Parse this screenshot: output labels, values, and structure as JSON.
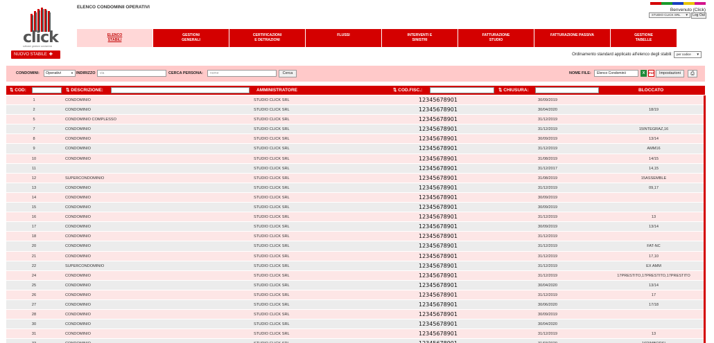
{
  "header": {
    "title": "ELENCO CONDOMINII OPERATIVI",
    "welcome": "Benvenuto",
    "click_link": "(Click)",
    "user_select": "STUDIO CLICK SRL",
    "logout": "Log Out",
    "logo_text": "click",
    "logo_tagline": "software gestione condominio",
    "strip_colors": [
      "#d40000",
      "#1a9a2a",
      "#1a3fbf",
      "#e8c400",
      "#d4148c"
    ]
  },
  "nav": [
    {
      "label": "ELENCO\nSTABILI",
      "active": true
    },
    {
      "label": "GESTIONI\nGENERALI",
      "active": false
    },
    {
      "label": "CERTIFICAZIONI\nE DETRAZIONI",
      "active": false
    },
    {
      "label": "FLUSSI",
      "active": false
    },
    {
      "label": "INTERVENTI E\nSINISTRI",
      "active": false
    },
    {
      "label": "FATTURAZIONE\nSTUDIO",
      "active": false
    },
    {
      "label": "FATTURAZIONE PASSIVA",
      "active": false
    },
    {
      "label": "GESTIONE\nTABELLE",
      "active": false
    }
  ],
  "new_button": "NUOVO STABILE",
  "ordering": {
    "label": "Ordinamento standard applicato all'elenco degli stabili:",
    "value": "per codice"
  },
  "filters": {
    "condomini_label": "CONDOMINI:",
    "condomini_value": "Operativi",
    "indirizzo_label": "INDIRIZZO",
    "indirizzo_placeholder": "via",
    "persona_label": "CERCA PERSONA:",
    "persona_placeholder": "nome",
    "cerca": "Cerca",
    "nome_file_label": "NOME FILE:",
    "nome_file_value": "Elenco Condominii",
    "impostazioni": "Impostazioni"
  },
  "columns": {
    "cod": "COD:",
    "descrizione": "DESCRIZIONE:",
    "amministratore": "AMMINISTRATORE",
    "codfisc": "COD.FISC.:",
    "chiusura": "CHIUSURA:",
    "bloccato": "BLOCCATO"
  },
  "colors": {
    "accent": "#d40000",
    "row_pink": "#fde6e6",
    "row_grey": "#ececec",
    "filter_bg": "#ffc9c9"
  },
  "rows": [
    {
      "cod": "1",
      "desc": "CONDOMINIO",
      "admin": "STUDIO CLICK SRL",
      "cf": "12345678901",
      "chiusura": "30/09/2019",
      "bloccato": ""
    },
    {
      "cod": "2",
      "desc": "CONDOMINIO",
      "admin": "STUDIO CLICK SRL",
      "cf": "12345678901",
      "chiusura": "30/04/2020",
      "bloccato": "18/19"
    },
    {
      "cod": "5",
      "desc": "CONDOMINIO COMPLESSO",
      "admin": "STUDIO CLICK SRL",
      "cf": "12345678901",
      "chiusura": "31/12/2019",
      "bloccato": ""
    },
    {
      "cod": "7",
      "desc": "CONDOMINIO",
      "admin": "STUDIO CLICK SRL",
      "cf": "12345678901",
      "chiusura": "31/12/2019",
      "bloccato": "15INTEGRAZ,16"
    },
    {
      "cod": "8",
      "desc": "CONDOMINIO",
      "admin": "STUDIO CLICK SRL",
      "cf": "12345678901",
      "chiusura": "30/09/2019",
      "bloccato": "13/14"
    },
    {
      "cod": "9",
      "desc": "CONDOMINIO",
      "admin": "STUDIO CLICK SRL",
      "cf": "12345678901",
      "chiusura": "31/12/2019",
      "bloccato": "AMM16"
    },
    {
      "cod": "10",
      "desc": "CONDOMINIO",
      "admin": "STUDIO CLICK SRL",
      "cf": "12345678901",
      "chiusura": "31/08/2019",
      "bloccato": "14/15"
    },
    {
      "cod": "11",
      "desc": "",
      "admin": "STUDIO CLICK SRL",
      "cf": "12345678901",
      "chiusura": "31/12/2017",
      "bloccato": "14,15"
    },
    {
      "cod": "12",
      "desc": "SUPERCONDOMINIO",
      "admin": "STUDIO CLICK SRL",
      "cf": "12345678901",
      "chiusura": "31/08/2019",
      "bloccato": "15ASSEMBLE"
    },
    {
      "cod": "13",
      "desc": "CONDOMINIO",
      "admin": "STUDIO CLICK SRL",
      "cf": "12345678901",
      "chiusura": "31/12/2019",
      "bloccato": "09,17"
    },
    {
      "cod": "14",
      "desc": "CONDOMINIO",
      "admin": "STUDIO CLICK SRL",
      "cf": "12345678901",
      "chiusura": "30/09/2019",
      "bloccato": ""
    },
    {
      "cod": "15",
      "desc": "CONDOMINIO",
      "admin": "STUDIO CLICK SRL",
      "cf": "12345678901",
      "chiusura": "30/09/2019",
      "bloccato": ""
    },
    {
      "cod": "16",
      "desc": "CONDOMINIO",
      "admin": "STUDIO CLICK SRL",
      "cf": "12345678901",
      "chiusura": "31/12/2019",
      "bloccato": "13"
    },
    {
      "cod": "17",
      "desc": "CONDOMINIO",
      "admin": "STUDIO CLICK SRL",
      "cf": "12345678901",
      "chiusura": "30/09/2019",
      "bloccato": "13/14"
    },
    {
      "cod": "18",
      "desc": "CONDOMINIO",
      "admin": "STUDIO CLICK SRL",
      "cf": "12345678901",
      "chiusura": "31/12/2019",
      "bloccato": ""
    },
    {
      "cod": "20",
      "desc": "CONDOMINIO",
      "admin": "STUDIO CLICK SRL",
      "cf": "12345678901",
      "chiusura": "31/12/2019",
      "bloccato": "FAT-NC"
    },
    {
      "cod": "21",
      "desc": "CONDOMINIO",
      "admin": "STUDIO CLICK SRL",
      "cf": "12345678901",
      "chiusura": "31/12/2019",
      "bloccato": "17,10"
    },
    {
      "cod": "22",
      "desc": "SUPERCONDOMINIO",
      "admin": "STUDIO CLICK SRL",
      "cf": "12345678901",
      "chiusura": "31/12/2019",
      "bloccato": "EX AMM"
    },
    {
      "cod": "24",
      "desc": "CONDOMINIO",
      "admin": "STUDIO CLICK SRL",
      "cf": "12345678901",
      "chiusura": "31/12/2019",
      "bloccato": "17PRESTITO,17PRESTITO,17PRESTITO"
    },
    {
      "cod": "25",
      "desc": "CONDOMINIO",
      "admin": "STUDIO CLICK SRL",
      "cf": "12345678901",
      "chiusura": "30/04/2020",
      "bloccato": "13/14"
    },
    {
      "cod": "26",
      "desc": "CONDOMINIO",
      "admin": "STUDIO CLICK SRL",
      "cf": "12345678901",
      "chiusura": "31/12/2019",
      "bloccato": "17"
    },
    {
      "cod": "27",
      "desc": "CONDOMINIO",
      "admin": "STUDIO CLICK SRL",
      "cf": "12345678901",
      "chiusura": "30/06/2020",
      "bloccato": "17/18"
    },
    {
      "cod": "28",
      "desc": "CONDOMINIO",
      "admin": "STUDIO CLICK SRL",
      "cf": "12345678901",
      "chiusura": "30/09/2019",
      "bloccato": ""
    },
    {
      "cod": "30",
      "desc": "CONDOMINIO",
      "admin": "STUDIO CLICK SRL",
      "cf": "12345678901",
      "chiusura": "30/04/2020",
      "bloccato": ""
    },
    {
      "cod": "31",
      "desc": "CONDOMINIO",
      "admin": "STUDIO CLICK SRL",
      "cf": "12345678901",
      "chiusura": "31/12/2019",
      "bloccato": "13"
    },
    {
      "cod": "33",
      "desc": "CONDOMINIO",
      "admin": "STUDIO CLICK SRL",
      "cf": "12345678901",
      "chiusura": "31/03/2020",
      "bloccato": "16RIMBORSI"
    }
  ]
}
